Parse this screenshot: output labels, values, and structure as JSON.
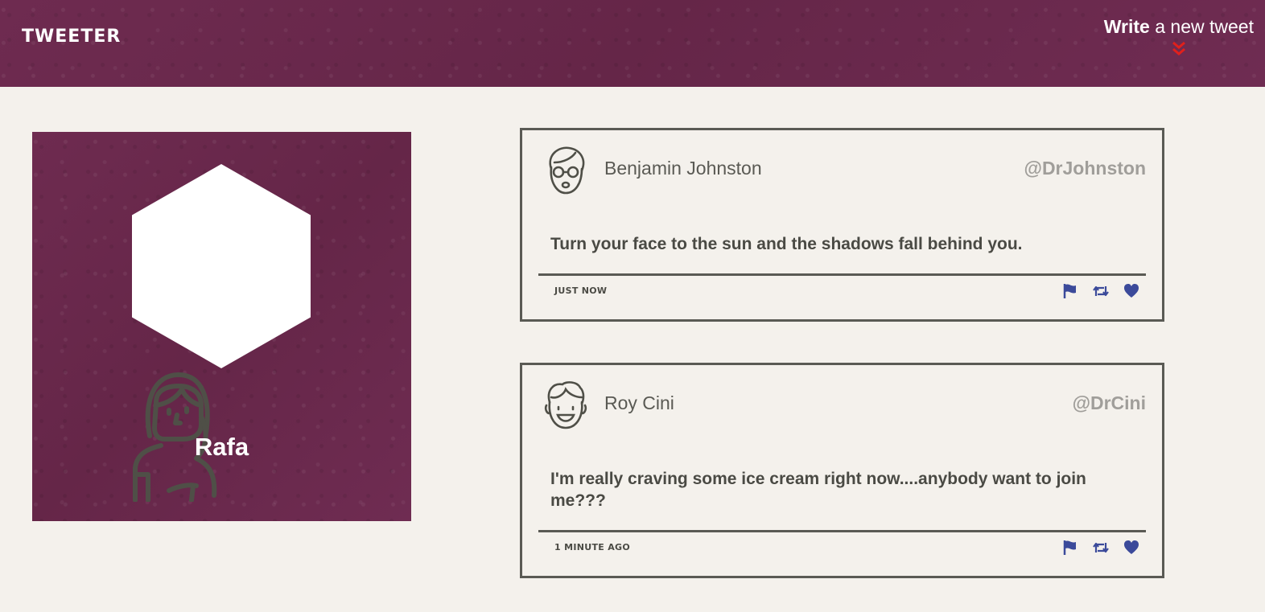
{
  "nav": {
    "brand": "TWEETER",
    "compose_bold": "Write",
    "compose_rest": " a new tweet",
    "compose_icon": "double-chevron-down-icon",
    "accent_color": "#e0201c"
  },
  "colors": {
    "brand_background": "#6b2a4e",
    "page_background": "#f4f1ec",
    "action_icon": "#3b4a9a",
    "text_dark": "#4a4a44",
    "handle_gray": "#a09e9a"
  },
  "profile": {
    "name": "Rafa",
    "avatar_icon": "woman-avatar-icon"
  },
  "tweets": [
    {
      "name": "Benjamin Johnston",
      "handle": "@DrJohnston",
      "avatar_icon": "man-with-glasses-avatar-icon",
      "text": "Turn your face to the sun and the shadows fall behind you.",
      "time": "JUST NOW",
      "actions": [
        "flag-icon",
        "retweet-icon",
        "heart-icon"
      ]
    },
    {
      "name": "Roy Cini",
      "handle": "@DrCini",
      "avatar_icon": "smiling-man-avatar-icon",
      "text": "I'm really craving some ice cream right now....anybody want to join me???",
      "time": "1 MINUTE AGO",
      "actions": [
        "flag-icon",
        "retweet-icon",
        "heart-icon"
      ]
    }
  ]
}
